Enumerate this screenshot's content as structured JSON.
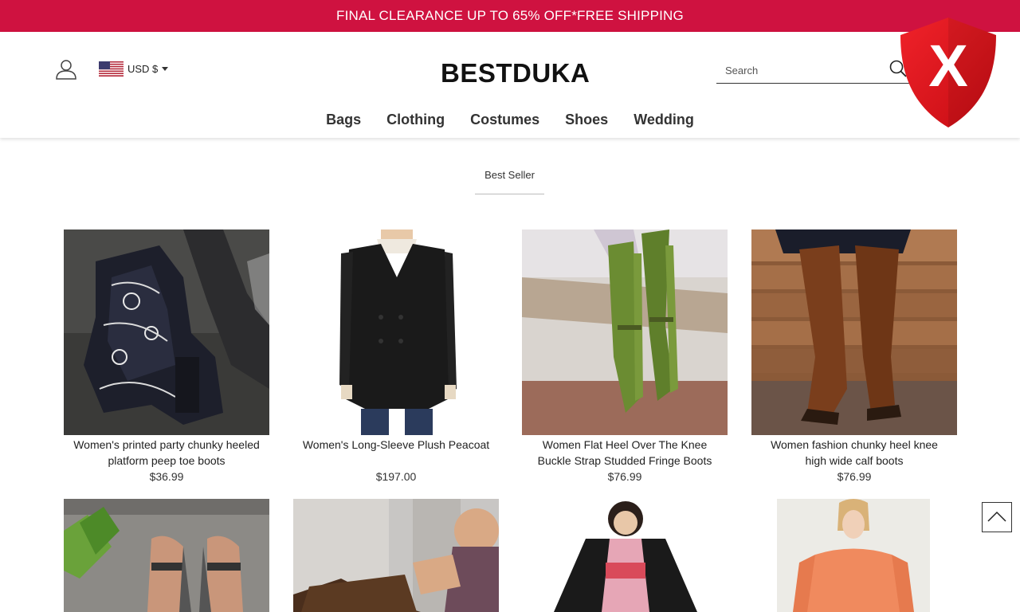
{
  "promo": {
    "text": "FINAL CLEARANCE UP TO 65% OFF*FREE SHIPPING"
  },
  "header": {
    "account_icon": "user-icon",
    "currency": {
      "label": "USD $",
      "flag": "us-flag-icon"
    },
    "logo": "BESTDUKA",
    "search": {
      "placeholder": "Search",
      "icon": "search-icon"
    },
    "nav": [
      {
        "label": "Bags"
      },
      {
        "label": "Clothing"
      },
      {
        "label": "Costumes"
      },
      {
        "label": "Shoes"
      },
      {
        "label": "Wedding"
      }
    ]
  },
  "overlay": {
    "badge": "X",
    "icon": "red-shield-x-icon"
  },
  "section": {
    "tab": "Best Seller"
  },
  "products": [
    {
      "title": "Women's printed party chunky heeled platform peep toe boots",
      "price": "$36.99",
      "image": "paisley-platform-boots"
    },
    {
      "title": "Women's Long-Sleeve Plush Peacoat",
      "price": "$197.00",
      "image": "black-peacoat"
    },
    {
      "title": "Women Flat Heel Over The Knee Buckle Strap Studded Fringe Boots",
      "price": "$76.99",
      "image": "green-fringe-boots"
    },
    {
      "title": "Women fashion chunky heel knee high wide calf boots",
      "price": "$76.99",
      "image": "brown-knee-boots"
    },
    {
      "title": "",
      "price": "",
      "image": "sandals"
    },
    {
      "title": "",
      "price": "",
      "image": "leather-bag"
    },
    {
      "title": "",
      "price": "",
      "image": "kimono-costume"
    },
    {
      "title": "",
      "price": "",
      "image": "orange-dress"
    }
  ],
  "back_to_top": {
    "icon": "chevron-up-icon"
  },
  "colors": {
    "promo_bg": "#cf1240",
    "shield": "#e8141c"
  }
}
